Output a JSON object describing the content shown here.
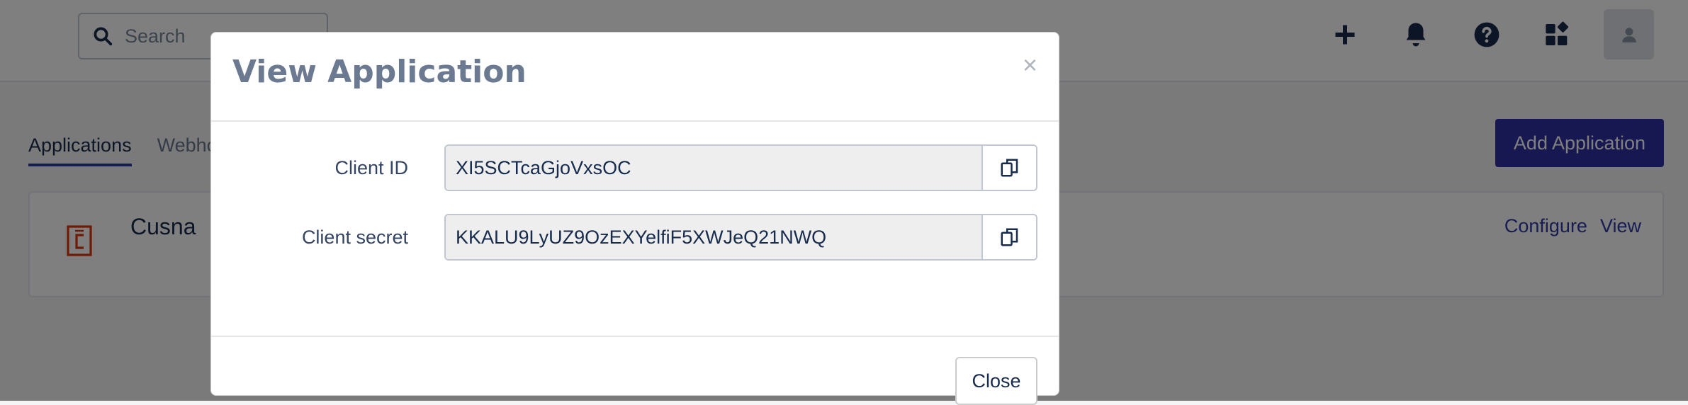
{
  "header": {
    "search_placeholder": "Search",
    "icons": [
      "plus-icon",
      "bell-icon",
      "help-icon",
      "apps-icon",
      "user-avatar-icon"
    ]
  },
  "tabs": [
    {
      "label": "Applications",
      "active": true
    },
    {
      "label": "Webho",
      "active": false
    }
  ],
  "add_button_label": "Add Application",
  "application": {
    "name": "Cusna",
    "configure_label": "Configure",
    "view_label": "View"
  },
  "modal": {
    "title": "View Application",
    "close_x": "×",
    "fields": [
      {
        "label": "Client ID",
        "value": "XI5SCTcaGjoVxsOC"
      },
      {
        "label": "Client secret",
        "value": "KKALU9LyUZ9OzEXYelfiF5XWJeQ21NWQ"
      }
    ],
    "close_button_label": "Close"
  },
  "colors": {
    "primary": "#2f2fa2",
    "link": "#2f3aa7",
    "title": "#6b7a91",
    "app_icon": "#de350b"
  }
}
